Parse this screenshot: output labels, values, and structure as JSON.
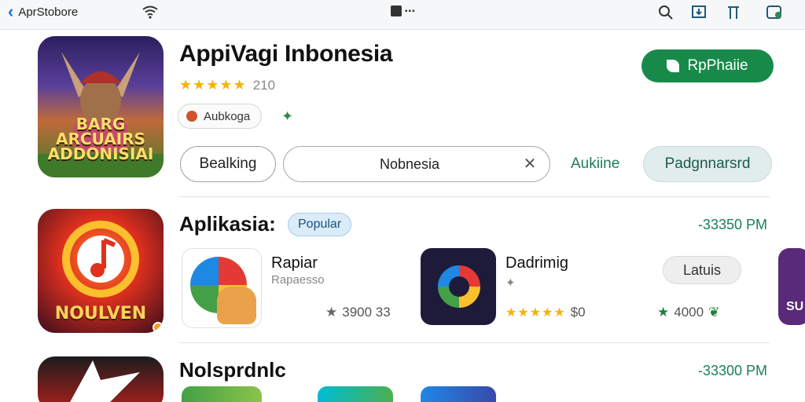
{
  "topbar": {
    "back_label": "AprStobore",
    "center_dots": "▪▪▪"
  },
  "header": {
    "title": "AppiVagi Inbonesia",
    "stars": "★★★★★",
    "rating_count": "210",
    "tag_label": "Aubkoga",
    "install_label": "RpPhaiie",
    "icon_caption_line1": "BARG ARCUAIRS",
    "icon_caption_line2": "ADDONISIAI"
  },
  "filters": {
    "booking_label": "Bealking",
    "search_value": "Nobnesia",
    "link_label": "Aukiine",
    "pad_label": "Padgnnarsrd"
  },
  "section1": {
    "title": "Aplikasia:",
    "badge": "Popular",
    "time": "-33350 PM",
    "icon_caption": "NOULVEN",
    "items": [
      {
        "name": "Rapiar",
        "sub": "Rapaesso",
        "stat": "3900 33"
      },
      {
        "name": "Dadrimig",
        "stars": "★★★★★",
        "stat": "$0"
      },
      {
        "stat": "4000"
      }
    ],
    "update_label": "Latuis",
    "edge_thumb_text": "SU"
  },
  "section2": {
    "title": "Nolsprdnlc",
    "time": "-33300 PM"
  },
  "colors": {
    "accent_green": "#178a4a",
    "link_green": "#1a7f5a",
    "star_gold": "#f5b400",
    "back_blue": "#1a73e8"
  }
}
